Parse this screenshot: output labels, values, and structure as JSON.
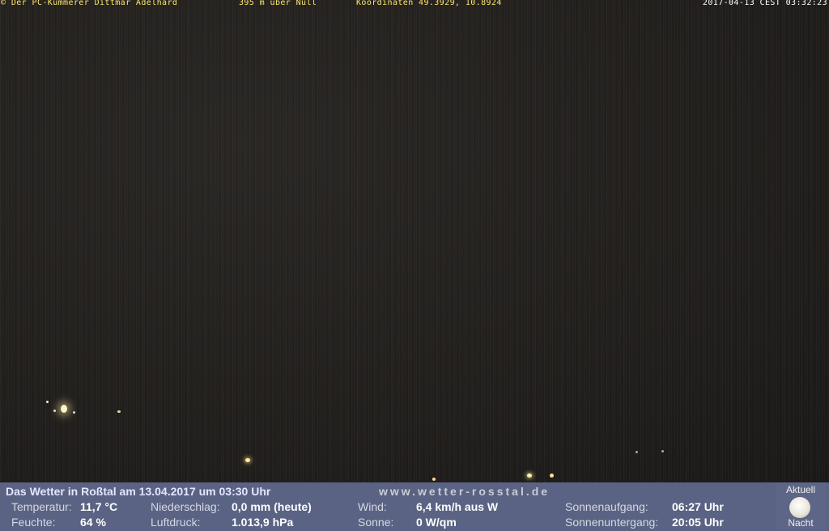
{
  "overlay": {
    "copyright": "© Der PC-Kümmerer Dittmar Adelhard",
    "altitude": "395 m über Null",
    "coordinates": "Koordinaten 49.3929, 10.8924",
    "timestamp": "2017-04-13 CEST 03:32:23"
  },
  "weather": {
    "title": "Das Wetter in Roßtal am 13.04.2017 um 03:30 Uhr",
    "website": "www.wetter-rosstal.de",
    "temperature": {
      "label": "Temperatur:",
      "value": "11,7 °C"
    },
    "humidity": {
      "label": "Feuchte:",
      "value": "64 %"
    },
    "precipitation": {
      "label": "Niederschlag:",
      "value": "0,0 mm (heute)"
    },
    "pressure": {
      "label": "Luftdruck:",
      "value": "1.013,9 hPa"
    },
    "wind": {
      "label": "Wind:",
      "value": "6,4 km/h aus W"
    },
    "sun": {
      "label": "Sonne:",
      "value": "0 W/qm"
    },
    "sunrise": {
      "label": "Sonnenaufgang:",
      "value": "06:27 Uhr"
    },
    "sunset": {
      "label": "Sonnenuntergang:",
      "value": "20:05 Uhr"
    },
    "current_label": "Aktuell",
    "current_condition": "Nacht",
    "current_icon": "moon-icon"
  },
  "colors": {
    "panel_bg": "#5a6383",
    "overlay_text": "#ffe86a"
  }
}
